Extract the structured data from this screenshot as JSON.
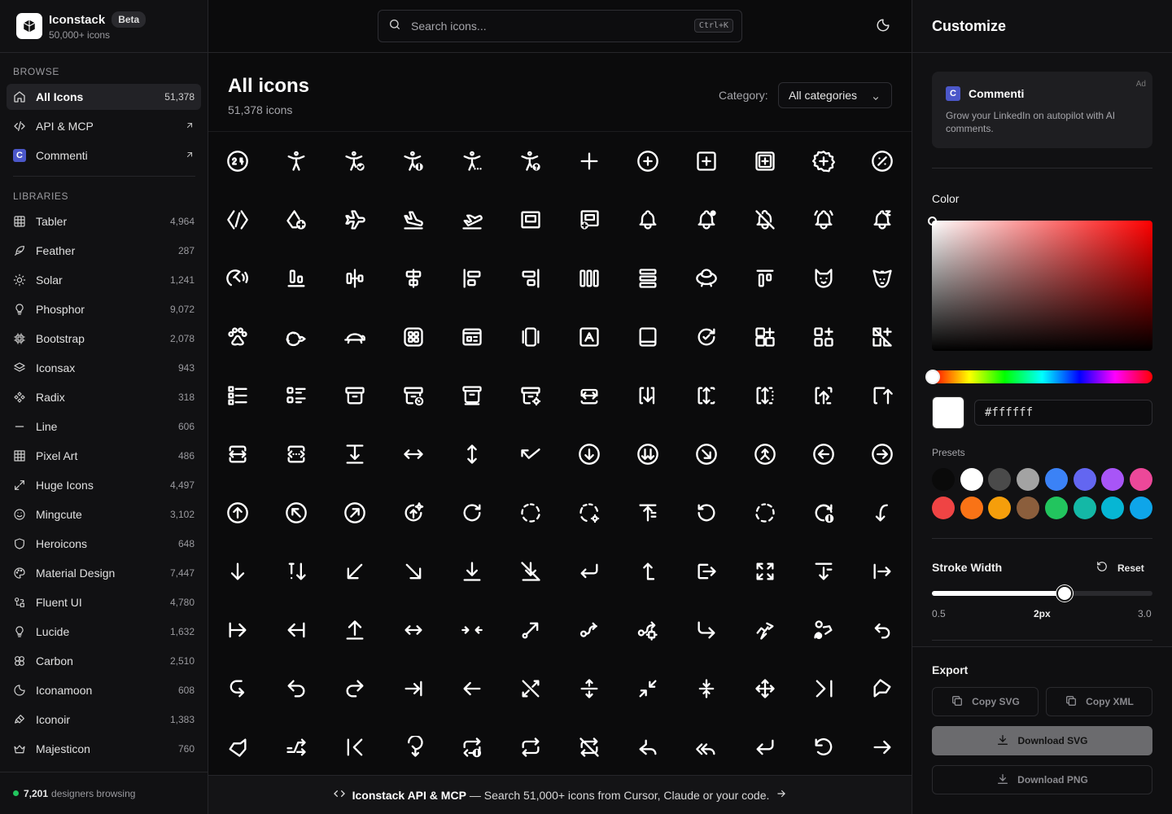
{
  "brand": {
    "name": "Iconstack",
    "badge": "Beta",
    "subtitle": "50,000+ icons"
  },
  "sidebar": {
    "browse_label": "BROWSE",
    "browse": [
      {
        "label": "All Icons",
        "count": "51,378",
        "icon": "home-icon",
        "active": true
      },
      {
        "label": "API & MCP",
        "icon": "code-icon",
        "external": true
      },
      {
        "label": "Commenti",
        "icon": "commenti-logo-icon",
        "external": true
      }
    ],
    "libraries_label": "LIBRARIES",
    "libraries": [
      {
        "label": "Tabler",
        "count": "4,964",
        "icon": "grid-table-icon"
      },
      {
        "label": "Feather",
        "count": "287",
        "icon": "feather-icon"
      },
      {
        "label": "Solar",
        "count": "1,241",
        "icon": "sun-icon"
      },
      {
        "label": "Phosphor",
        "count": "9,072",
        "icon": "lightbulb-icon"
      },
      {
        "label": "Bootstrap",
        "count": "2,078",
        "icon": "chip-icon"
      },
      {
        "label": "Iconsax",
        "count": "943",
        "icon": "layers-icon"
      },
      {
        "label": "Radix",
        "count": "318",
        "icon": "components-icon"
      },
      {
        "label": "Line",
        "count": "606",
        "icon": "minus-icon"
      },
      {
        "label": "Pixel Art",
        "count": "486",
        "icon": "pixel-grid-icon"
      },
      {
        "label": "Huge Icons",
        "count": "4,497",
        "icon": "expand-icon"
      },
      {
        "label": "Mingcute",
        "count": "3,102",
        "icon": "smile-icon"
      },
      {
        "label": "Heroicons",
        "count": "648",
        "icon": "shield-icon"
      },
      {
        "label": "Material Design",
        "count": "7,447",
        "icon": "palette-icon"
      },
      {
        "label": "Fluent UI",
        "count": "4,780",
        "icon": "shapes-icon"
      },
      {
        "label": "Lucide",
        "count": "1,632",
        "icon": "lightbulb-icon"
      },
      {
        "label": "Carbon",
        "count": "2,510",
        "icon": "carbon-icon"
      },
      {
        "label": "Iconamoon",
        "count": "608",
        "icon": "moon-icon"
      },
      {
        "label": "Iconoir",
        "count": "1,383",
        "icon": "brush-icon"
      },
      {
        "label": "Majesticon",
        "count": "760",
        "icon": "crown-icon"
      }
    ],
    "footer": {
      "count": "7,201",
      "text": "designers browsing"
    }
  },
  "search": {
    "placeholder": "Search icons...",
    "shortcut": "Ctrl+K"
  },
  "main": {
    "title": "All icons",
    "subtitle": "51,378 icons",
    "category_label": "Category:",
    "category_value": "All categories"
  },
  "icon_grid": {
    "rows": [
      [
        "clock-24-icon",
        "accessible-icon",
        "accessible-check-icon",
        "accessible-info-icon",
        "accessible-dots-icon",
        "accessible-question-icon",
        "plus-icon",
        "circle-plus-icon",
        "square-plus-icon",
        "square-plus-stack-icon",
        "badge-plus-icon",
        "circle-percent-icon"
      ],
      [
        "code-diamond-icon",
        "shapes-plus-icon",
        "airplane-icon",
        "plane-arrival-icon",
        "plane-departure-icon",
        "panel-icon",
        "panel-plus-icon",
        "bell-icon",
        "bell-dot-icon",
        "bell-off-icon",
        "bell-ringing-icon",
        "bell-zzz-icon"
      ],
      [
        "alert-ring-icon",
        "align-bottom-icon",
        "align-center-icon",
        "align-box-center-icon",
        "align-left-icon",
        "align-right-icon",
        "columns-icon",
        "rows-icon",
        "ufo-icon",
        "align-top-icon",
        "cat-icon",
        "dog-icon"
      ],
      [
        "paw-icon",
        "rodent-icon",
        "turtle-icon",
        "apps-grid-icon",
        "app-window-icon",
        "carousel-icon",
        "app-store-icon",
        "tablet-icon",
        "refresh-check-icon",
        "cube-plus-icon",
        "layout-grid-add-icon",
        "layout-grid-off-icon"
      ],
      [
        "list-icon",
        "list-details-icon",
        "archive-icon",
        "archive-restore-icon",
        "archive-stack-icon",
        "archive-settings-icon",
        "arrow-autofit-icon",
        "arrow-bar-down-icon",
        "arrow-bar-both-icon",
        "arrow-bar-dotted-icon",
        "arrow-bar-up-icon",
        "arrow-corner-up-icon"
      ],
      [
        "arrows-horizontal-box-icon",
        "arrows-dots-box-icon",
        "arrow-bar-to-down-icon",
        "arrows-left-right-icon",
        "arrows-up-down-icon",
        "arrow-bounce-icon",
        "circle-arrow-down-icon",
        "circle-double-down-icon",
        "circle-arrow-down-right-icon",
        "circle-merge-icon",
        "circle-arrow-left-icon",
        "circle-arrow-right-icon"
      ],
      [
        "circle-arrow-up-icon",
        "circle-arrow-up-left-icon",
        "circle-arrow-up-right-icon",
        "circle-sparkle-icon",
        "rotate-cw-icon",
        "dashed-circle-icon",
        "dashed-refresh-settings-icon",
        "arrow-bar-to-up-icon",
        "rotate-ccw-icon",
        "dashed-circle-alt-icon",
        "refresh-info-icon",
        "arrow-curve-down-icon"
      ],
      [
        "arrow-down-icon",
        "sort-exclamation-icon",
        "arrow-down-left-icon",
        "arrow-down-right-icon",
        "arrow-bar-download-icon",
        "arrow-download-off-icon",
        "arrow-return-icon",
        "arrow-up-stem-icon",
        "arrow-right-box-icon",
        "maximize-icon",
        "sort-down-bar-icon",
        "arrow-right-bar-icon"
      ],
      [
        "arrow-bar-right-icon",
        "arrow-bar-left-icon",
        "arrow-bar-up-line-icon",
        "arrows-horizontal-icon",
        "arrows-converge-icon",
        "arrow-up-right-circle-icon",
        "arrow-route-icon",
        "route-settings-icon",
        "arrow-forward-icon",
        "arrow-lightning-icon",
        "arrow-user-icon",
        "arrow-return-left-icon"
      ],
      [
        "arrow-curve-back-icon",
        "undo-icon",
        "redo-icon",
        "arrow-right-to-bar-icon",
        "arrow-left-icon",
        "arrows-diagonal-icon",
        "arrows-vertical-center-icon",
        "arrows-minimize-icon",
        "arrows-merge-vertical-icon",
        "arrows-move-icon",
        "arrow-skip-bar-icon",
        "arrow-badge-icon"
      ],
      [
        "arrow-badge-alt-icon",
        "arrows-cross-icon",
        "chevron-left-bar-icon",
        "arrow-loop-icon",
        "repeat-info-icon",
        "repeat-icon",
        "repeat-off-icon",
        "reply-icon",
        "reply-all-icon",
        "arrow-enter-icon",
        "rotate-back-icon",
        "arrow-right-icon"
      ]
    ]
  },
  "banner": {
    "title": "Iconstack API & MCP",
    "text": "— Search 51,000+ icons from Cursor, Claude or your code."
  },
  "panel": {
    "title": "Customize",
    "ad": {
      "tag": "Ad",
      "title": "Commenti",
      "text": "Grow your LinkedIn on autopilot with AI comments."
    },
    "color_label": "Color",
    "hex_value": "#ffffff",
    "presets_label": "Presets",
    "presets": [
      "#0a0a0a",
      "#ffffff",
      "#4a4a4a",
      "#a3a3a3",
      "#3b82f6",
      "#6366f1",
      "#a855f7",
      "#ec4899",
      "#ef4444",
      "#f97316",
      "#f59e0b",
      "#8b5e3c",
      "#22c55e",
      "#14b8a6",
      "#06b6d4",
      "#0ea5e9"
    ],
    "stroke_label": "Stroke Width",
    "reset_label": "Reset",
    "stroke": {
      "min": "0.5",
      "max": "3.0",
      "current": "2px",
      "value": 2,
      "min_value": 0.5,
      "max_value": 3.0
    },
    "export_label": "Export",
    "copy_svg": "Copy SVG",
    "copy_xml": "Copy XML",
    "download_svg": "Download SVG",
    "download_png": "Download PNG"
  }
}
